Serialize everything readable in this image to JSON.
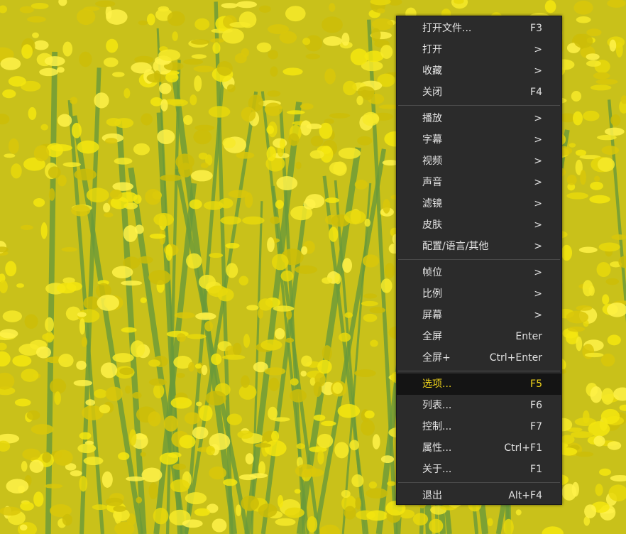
{
  "background": {
    "description_colors": {
      "flower": "#f4e60f",
      "stem": "#6a9a3a",
      "base": "#c9c11a"
    }
  },
  "menu": {
    "highlight_color": "#f1d51a",
    "groups": [
      [
        {
          "label": "打开文件...",
          "shortcut": "F3"
        },
        {
          "label": "打开",
          "shortcut": ">"
        },
        {
          "label": "收藏",
          "shortcut": ">"
        },
        {
          "label": "关闭",
          "shortcut": "F4"
        }
      ],
      [
        {
          "label": "播放",
          "shortcut": ">"
        },
        {
          "label": "字幕",
          "shortcut": ">"
        },
        {
          "label": "视频",
          "shortcut": ">"
        },
        {
          "label": "声音",
          "shortcut": ">"
        },
        {
          "label": "滤镜",
          "shortcut": ">"
        },
        {
          "label": "皮肤",
          "shortcut": ">"
        },
        {
          "label": "配置/语言/其他",
          "shortcut": ">"
        }
      ],
      [
        {
          "label": "帧位",
          "shortcut": ">"
        },
        {
          "label": "比例",
          "shortcut": ">"
        },
        {
          "label": "屏幕",
          "shortcut": ">"
        },
        {
          "label": "全屏",
          "shortcut": "Enter"
        },
        {
          "label": "全屏+",
          "shortcut": "Ctrl+Enter"
        }
      ],
      [
        {
          "label": "选项...",
          "shortcut": "F5",
          "highlighted": true
        },
        {
          "label": "列表...",
          "shortcut": "F6"
        },
        {
          "label": "控制...",
          "shortcut": "F7"
        },
        {
          "label": "属性...",
          "shortcut": "Ctrl+F1"
        },
        {
          "label": "关于...",
          "shortcut": "F1"
        }
      ],
      [
        {
          "label": "退出",
          "shortcut": "Alt+F4"
        }
      ]
    ]
  }
}
